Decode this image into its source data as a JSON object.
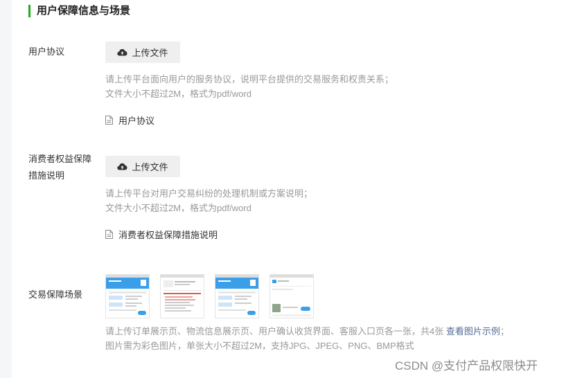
{
  "section": {
    "title": "用户保障信息与场景"
  },
  "user_agreement": {
    "label": "用户协议",
    "upload_label": "上传文件",
    "hint_line1": "请上传平台面向用户的服务协议，说明平台提供的交易服务和权责关系；",
    "hint_line2": "文件大小不超过2M，格式为pdf/word",
    "file_name": "用户协议"
  },
  "consumer_rights": {
    "label_line1": "消费者权益保障",
    "label_line2": "措施说明",
    "upload_label": "上传文件",
    "hint_line1": "请上传平台对用户交易纠纷的处理机制或方案说明；",
    "hint_line2": "文件大小不超过2M，格式为pdf/word",
    "file_name": "消费者权益保障措施说明"
  },
  "scenes": {
    "label": "交易保障场景",
    "hint_line1_prefix": "请上传订单展示页、物流信息展示页、用户确认收货界面、客服入口页各一张，共4张 ",
    "example_link": "查看图片示例",
    "hint_line1_suffix": "；",
    "hint_line2": "图片需为彩色图片，单张大小不超过2M，支持JPG、JPEG、PNG、BMP格式"
  },
  "watermark": "CSDN @支付产品权限快开",
  "colors": {
    "accent": "#1aad19",
    "link": "#576b95",
    "hint": "#999999",
    "button_bg": "#efefef"
  },
  "icons": {
    "upload": "cloud-upload-icon",
    "file": "document-icon"
  }
}
